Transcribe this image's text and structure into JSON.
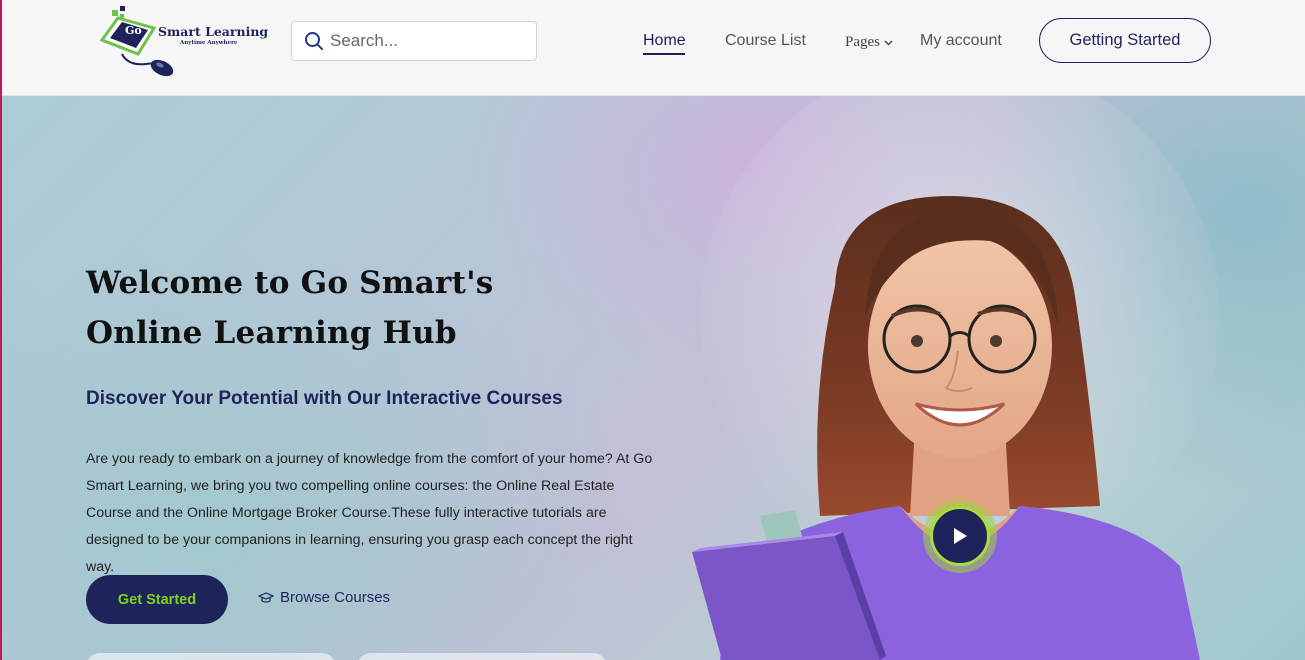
{
  "brand": {
    "logo_mark": "Go",
    "name": "Smart Learning",
    "tagline": "Anytime Anywhere"
  },
  "search": {
    "placeholder": "Search...",
    "icon": "search-icon"
  },
  "nav": {
    "items": [
      {
        "label": "Home",
        "active": true
      },
      {
        "label": "Course List"
      },
      {
        "label": "Pages",
        "icon": "chevron-down-icon"
      },
      {
        "label": "My account"
      }
    ],
    "cta_label": "Getting Started"
  },
  "hero": {
    "title": "Welcome to Go Smart's Online Learning Hub",
    "subtitle": "Discover Your Potential with Our Interactive Courses",
    "body": "Are you ready to embark on a journey of knowledge from the comfort of your home? At Go Smart Learning, we bring you two compelling online courses: the Online Real Estate Course and the Online Mortgage Broker Course.These fully interactive tutorials are designed to be your companions in learning, ensuring you grasp each concept the right way.",
    "primary_cta": "Get Started",
    "secondary_cta": "Browse Courses",
    "secondary_icon": "graduation-cap-icon",
    "video_icon": "play-icon"
  },
  "colors": {
    "brand_navy": "#1e2459",
    "accent_green": "#7ed321",
    "shirt_purple": "#8c63df"
  }
}
